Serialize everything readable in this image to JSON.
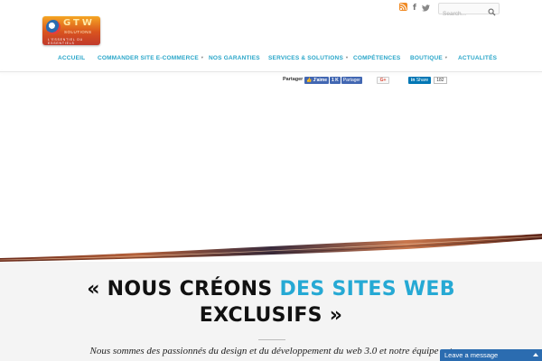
{
  "topbar": {
    "social": {
      "rss_icon": "rss-icon",
      "facebook_glyph": "f",
      "twitter_icon": "twitter-icon"
    },
    "search": {
      "placeholder": "Search...",
      "icon": "search-icon"
    }
  },
  "logo": {
    "letters": "GTW",
    "sub": "SOLUTIONS",
    "tagline": "L'ESSENTIEL DU ESSENTIELS"
  },
  "nav": {
    "items": [
      {
        "label": "ACCUEIL",
        "has_dropdown": false
      },
      {
        "label": "COMMANDER SITE E-COMMERCE",
        "has_dropdown": true
      },
      {
        "label": "NOS GARANTIES",
        "has_dropdown": false
      },
      {
        "label": "SERVICES & SOLUTIONS",
        "has_dropdown": true
      },
      {
        "label": "COMPÉTENCES",
        "has_dropdown": false
      },
      {
        "label": "BOUTIQUE",
        "has_dropdown": true
      },
      {
        "label": "ACTUALITÉS",
        "has_dropdown": false
      }
    ],
    "caret": "▼"
  },
  "share": {
    "label": "Partager",
    "fb_like": "J'aime",
    "fb_like_count": "1",
    "fb_count_k": "K",
    "fb_share": "Partager",
    "gplus": "G+",
    "linkedin": "Share",
    "linkedin_count": "182"
  },
  "hero": {
    "headline_part1": "« NOUS CRÉONS",
    "headline_accent": "DES SITES WEB",
    "headline_part2": "EXCLUSIFS »",
    "intro": "Nous sommes des passionnés du design et du développement du web 3.0 et notre équipe est",
    "accent_color": "#26a9d4"
  },
  "chat": {
    "label": "Leave a message"
  },
  "colors": {
    "nav": "#29a6c9",
    "facebook": "#4267b2",
    "linkedin": "#0077b5",
    "chat": "#2b6cb0"
  }
}
